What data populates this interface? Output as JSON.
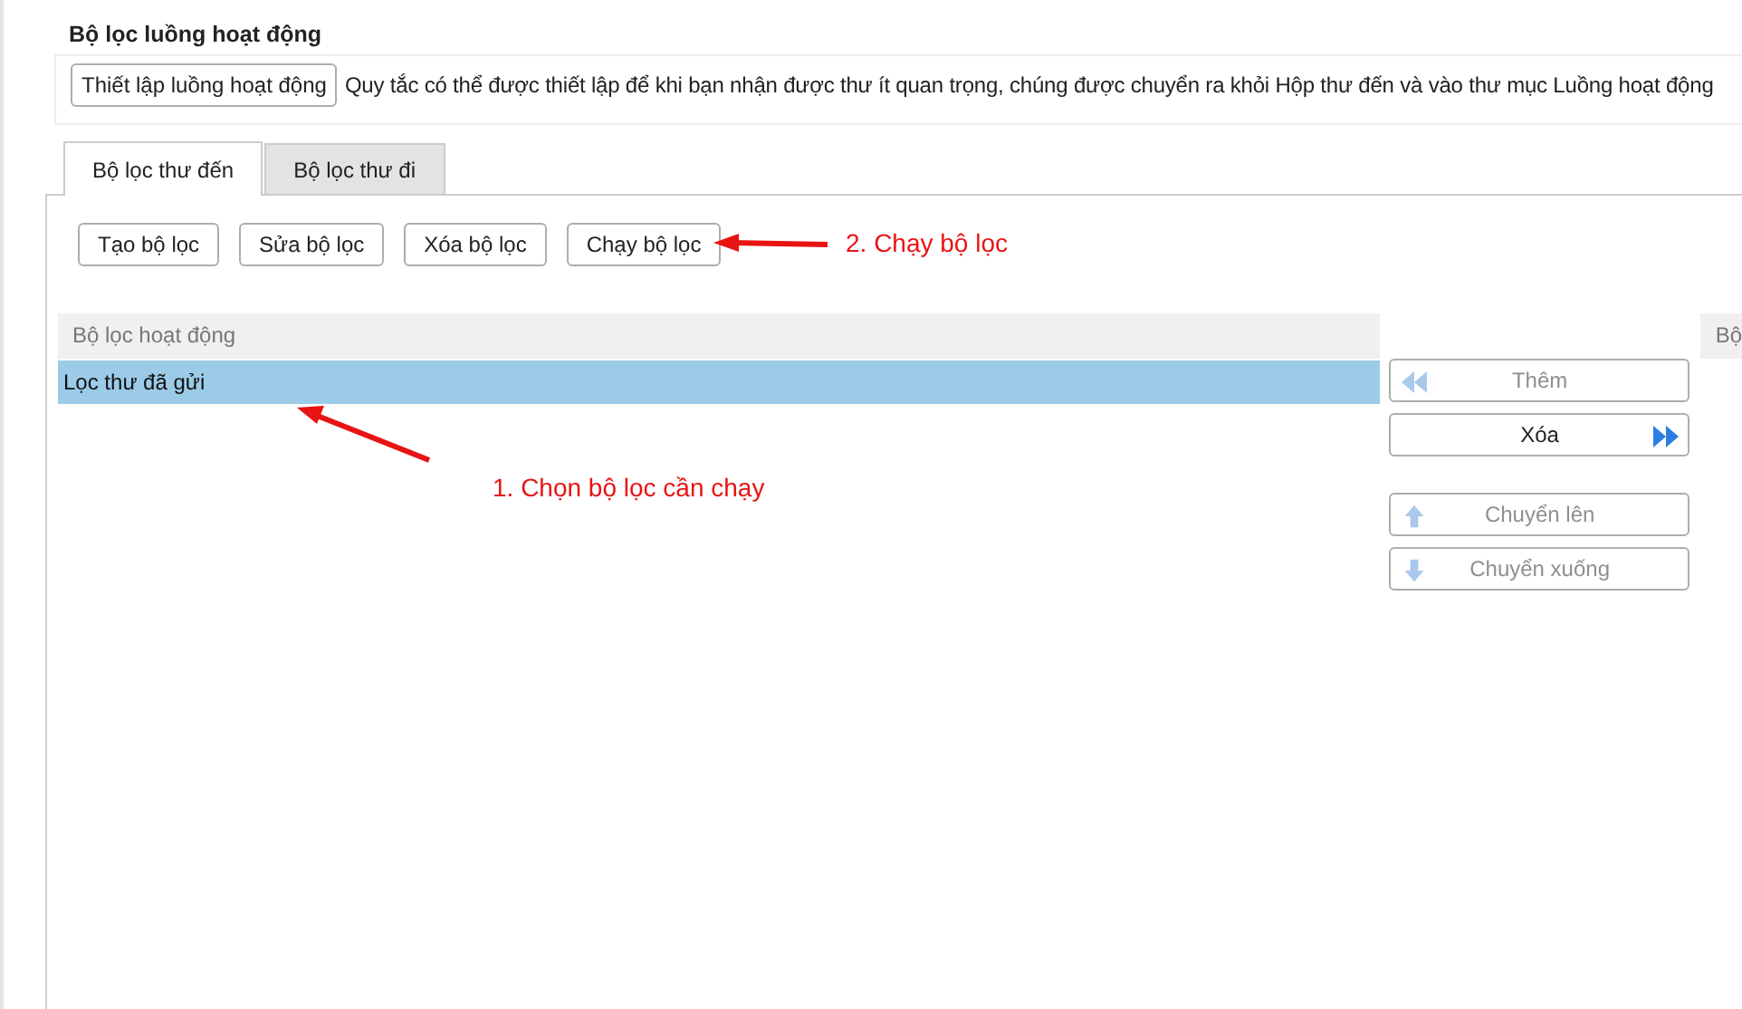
{
  "rules_section": {
    "title": "Bộ lọc luồng hoạt động",
    "setup_button": "Thiết lập luồng hoạt động",
    "description": "Quy tắc có thể được thiết lập để khi bạn nhận được thư ít quan trọng, chúng được chuyển ra khỏi Hộp thư đến và vào thư mục Luồng hoạt động"
  },
  "tabs": [
    {
      "label": "Bộ lọc thư đến",
      "selected": true
    },
    {
      "label": "Bộ lọc thư đi",
      "selected": false
    }
  ],
  "toolbar": [
    "Tạo bộ lọc",
    "Sửa bộ lọc",
    "Xóa bộ lọc",
    "Chạy bộ lọc"
  ],
  "active_filters": {
    "header": "Bộ lọc hoạt động",
    "rows": [
      {
        "name": "Lọc thư đã gửi",
        "selected": true
      }
    ]
  },
  "side_buttons": [
    {
      "label": "Thêm",
      "kind": "left",
      "disabled": true
    },
    {
      "label": "Xóa",
      "kind": "right",
      "disabled": false
    },
    {
      "label": "Chuyển lên",
      "kind": "up",
      "disabled": true
    },
    {
      "label": "Chuyển xuống",
      "kind": "down",
      "disabled": true
    }
  ],
  "other_list": {
    "header": "Bộ"
  },
  "annotations": [
    {
      "kind": "run",
      "text": "2. Chạy bộ lọc"
    },
    {
      "kind": "select",
      "text": "1. Chọn bộ lọc cần chạy"
    }
  ]
}
